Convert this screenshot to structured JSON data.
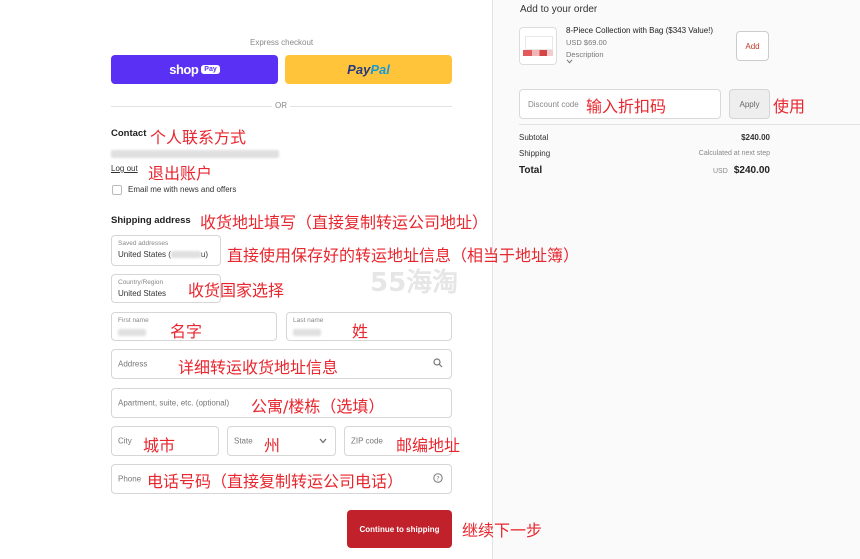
{
  "express": {
    "label": "Express checkout",
    "shop_label": "shop",
    "shop_pay_badge": "Pay",
    "paypal_part1": "Pay",
    "paypal_part2": "Pal",
    "or_label": "OR"
  },
  "contact": {
    "heading": "Contact",
    "logout": "Log out",
    "email_offers": "Email me with news and offers"
  },
  "shipping": {
    "heading": "Shipping address",
    "saved_label": "Saved addresses",
    "saved_value_prefix": "United States (",
    "saved_value_suffix": "u)",
    "country_label": "Country/Region",
    "country_value": "United States",
    "first_name_label": "First name",
    "last_name_label": "Last name",
    "address_ph": "Address",
    "apartment_ph": "Apartment, suite, etc. (optional)",
    "city_ph": "City",
    "state_ph": "State",
    "zip_ph": "ZIP code",
    "phone_ph": "Phone",
    "continue": "Continue to shipping"
  },
  "summary": {
    "add_title": "Add to your order",
    "product_name": "8-Piece Collection with Bag ($343 Value!)",
    "product_price": "USD $69.00",
    "product_desc": "Description",
    "add_button": "Add",
    "discount_ph": "Discount code",
    "apply_button": "Apply",
    "subtotal_label": "Subtotal",
    "subtotal_value": "$240.00",
    "shipping_label": "Shipping",
    "shipping_value": "Calculated at next step",
    "total_label": "Total",
    "total_currency": "USD",
    "total_value": "$240.00"
  },
  "annotations": {
    "contact": "个人联系方式",
    "logout": "退出账户",
    "shipping": "收货地址填写（直接复制转运公司地址）",
    "saved": "直接使用保存好的转运地址信息（相当于地址簿）",
    "country": "收货国家选择",
    "first_name": "名字",
    "last_name": "姓",
    "address": "详细转运收货地址信息",
    "apartment": "公寓/楼栋（选填）",
    "city": "城市",
    "state": "州",
    "zip": "邮编地址",
    "phone": "电话号码（直接复制转运公司电话）",
    "continue": "继续下一步",
    "discount": "输入折扣码",
    "apply": "使用"
  },
  "watermark": "55海淘",
  "colors": {
    "shop_pay": "#5a31f4",
    "paypal": "#ffc439",
    "continue": "#c0212b",
    "annotation": "#e8262e"
  },
  "icons": {
    "search": "search-icon",
    "chevron": "chevron-down-icon",
    "help": "help-circle-icon"
  }
}
